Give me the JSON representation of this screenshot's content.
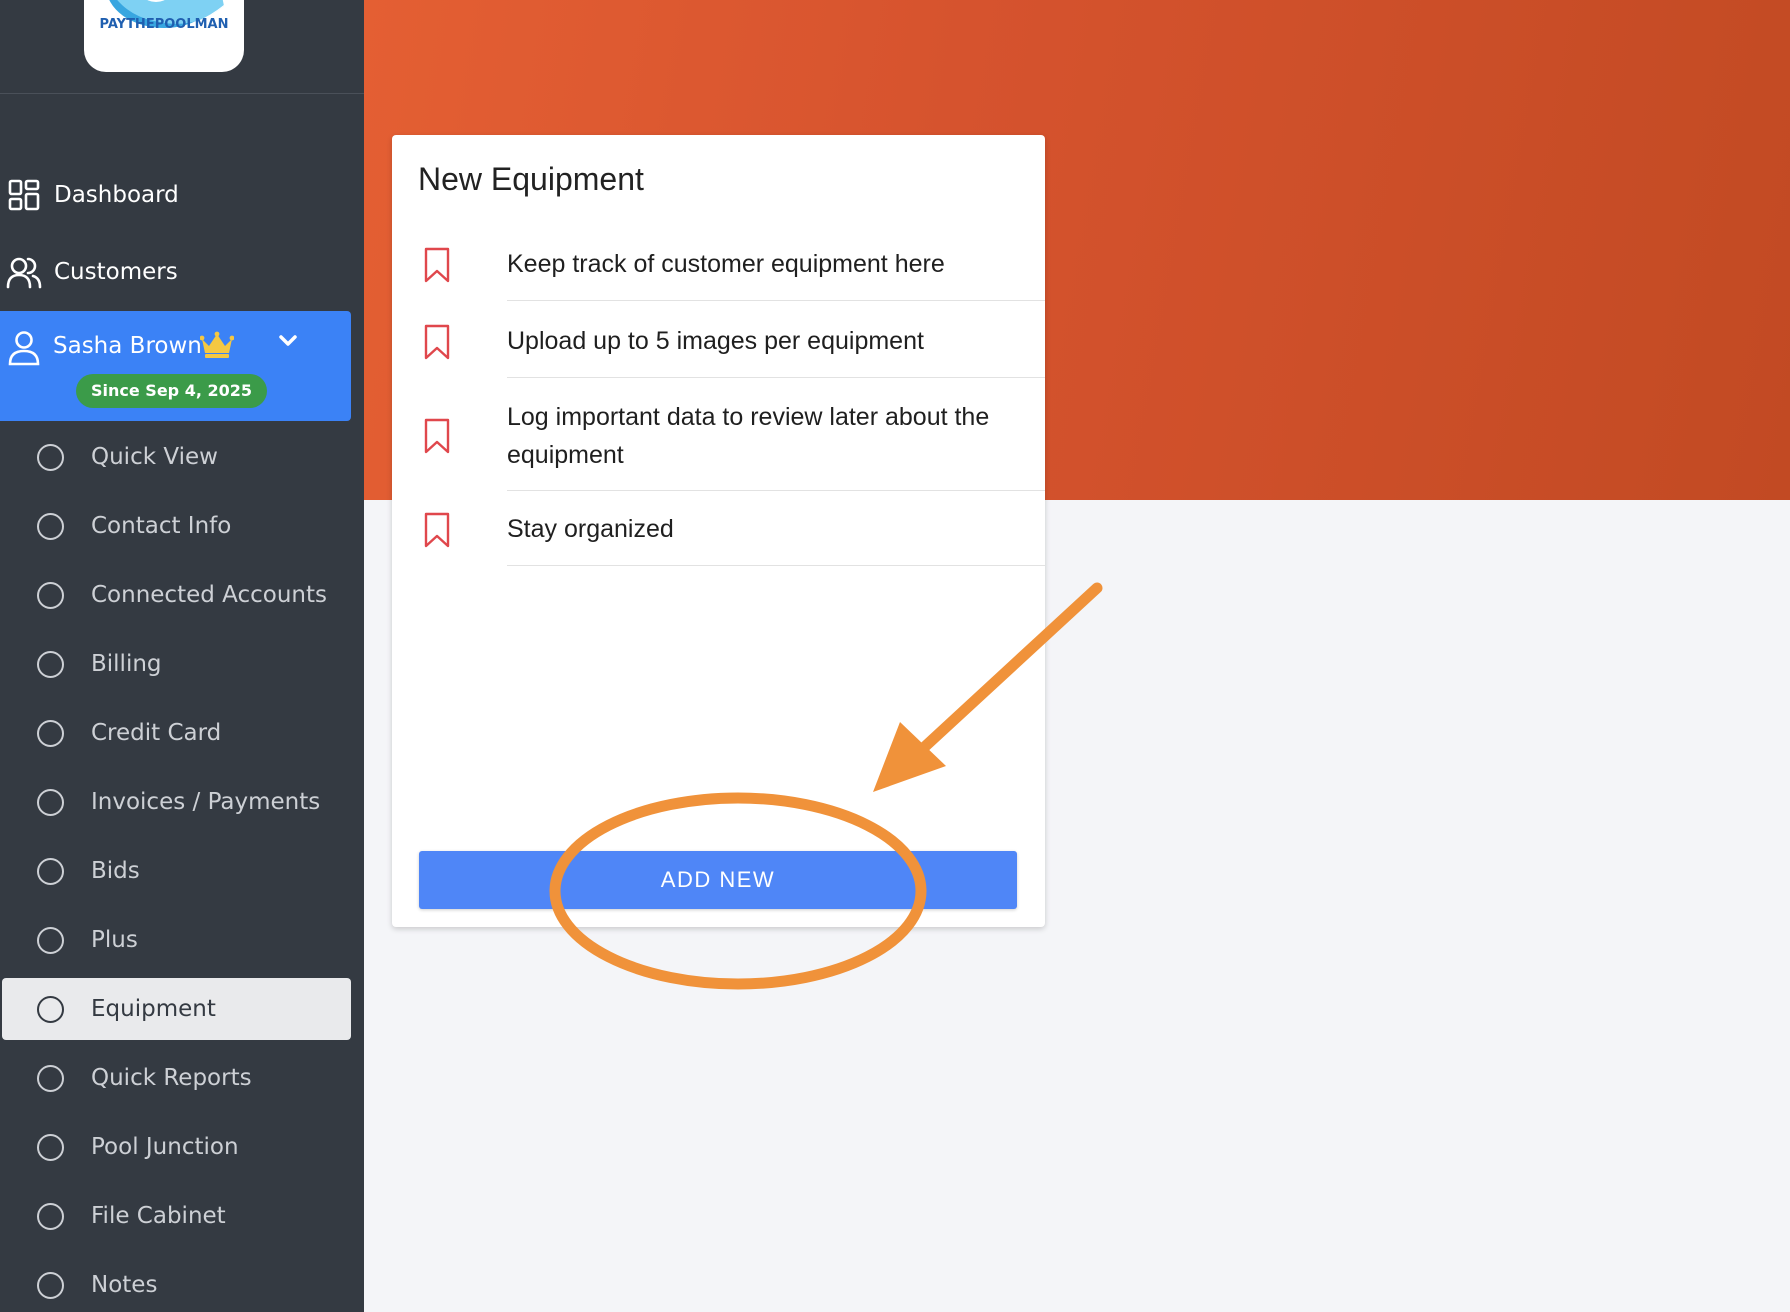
{
  "brand": {
    "logo_text": "PAYTHEPOOLMAN"
  },
  "nav": {
    "dashboard": "Dashboard",
    "customers": "Customers"
  },
  "customer": {
    "name": "Sasha Brown",
    "since": "Since Sep 4, 2025"
  },
  "submenu": [
    {
      "label": "Quick View"
    },
    {
      "label": "Contact Info"
    },
    {
      "label": "Connected Accounts"
    },
    {
      "label": "Billing"
    },
    {
      "label": "Credit Card"
    },
    {
      "label": "Invoices / Payments"
    },
    {
      "label": "Bids"
    },
    {
      "label": "Plus"
    },
    {
      "label": "Equipment",
      "active": true
    },
    {
      "label": "Quick Reports"
    },
    {
      "label": "Pool Junction"
    },
    {
      "label": "File Cabinet"
    },
    {
      "label": "Notes"
    }
  ],
  "card": {
    "title": "New Equipment",
    "features": [
      "Keep track of customer equipment here",
      "Upload up to 5 images per equipment",
      "Log important data to review later about the equipment",
      "Stay organized"
    ],
    "button": "ADD NEW"
  },
  "colors": {
    "sidebar": "#343a42",
    "customer_highlight": "#3b82f6",
    "badge": "#3b9b49",
    "hero": "#d6532e",
    "button": "#4f86f7",
    "bookmark": "#e0474c",
    "annotation": "#f0923a",
    "crown": "#f5c842"
  },
  "icons": [
    "dashboard-icon",
    "users-icon",
    "user-icon",
    "crown-icon",
    "chevron-down-icon",
    "bookmark-icon",
    "circle-icon"
  ]
}
